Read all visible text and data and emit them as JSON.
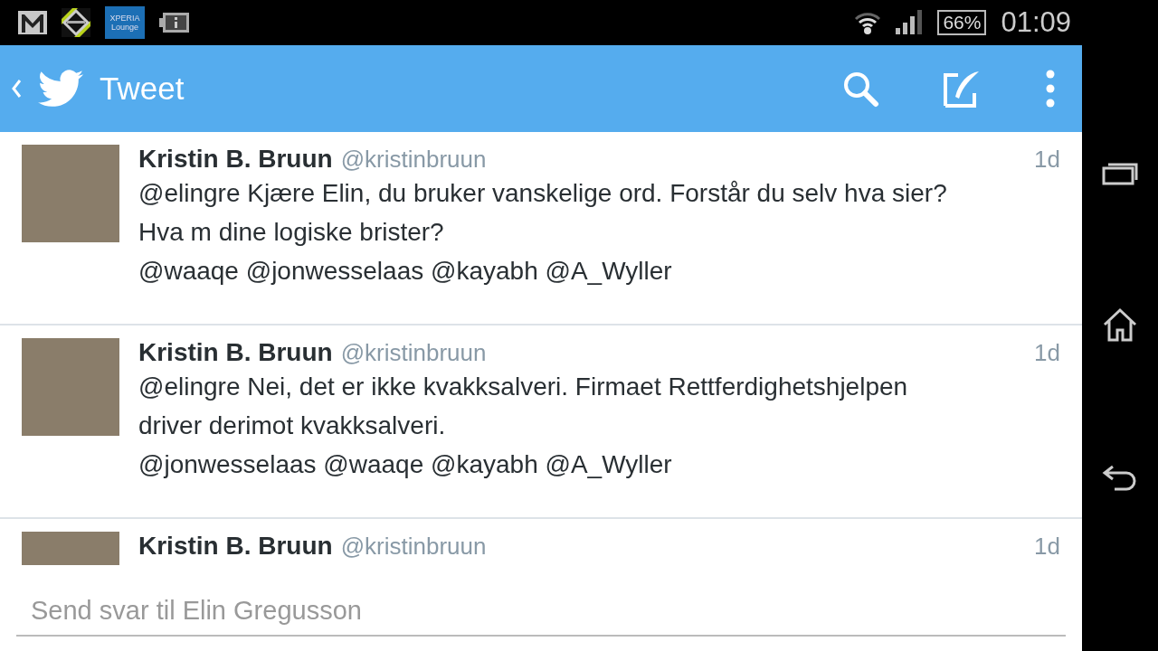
{
  "status_bar": {
    "notification_badge": "XPERIA Lounge",
    "battery": "66%",
    "time": "01:09"
  },
  "app_bar": {
    "title": "Tweet"
  },
  "tweets": [
    {
      "name": "Kristin B. Bruun",
      "handle": "@kristinbruun",
      "time": "1d",
      "text": "@elingre Kjære Elin, du bruker vanskelige ord. Forstår du selv hva sier? Hva m dine logiske brister?",
      "mentions": "@waaqe @jonwesselaas @kayabh @A_Wyller"
    },
    {
      "name": "Kristin B. Bruun",
      "handle": "@kristinbruun",
      "time": "1d",
      "text": "@elingre Nei, det er ikke kvakksalveri. Firmaet Rettferdighetshjelpen driver derimot kvakksalveri.",
      "mentions": "@jonwesselaas @waaqe @kayabh @A_Wyller"
    },
    {
      "name": "Kristin B. Bruun",
      "handle": "@kristinbruun",
      "time": "1d"
    }
  ],
  "reply": {
    "placeholder": "Send svar til Elin Gregusson"
  }
}
